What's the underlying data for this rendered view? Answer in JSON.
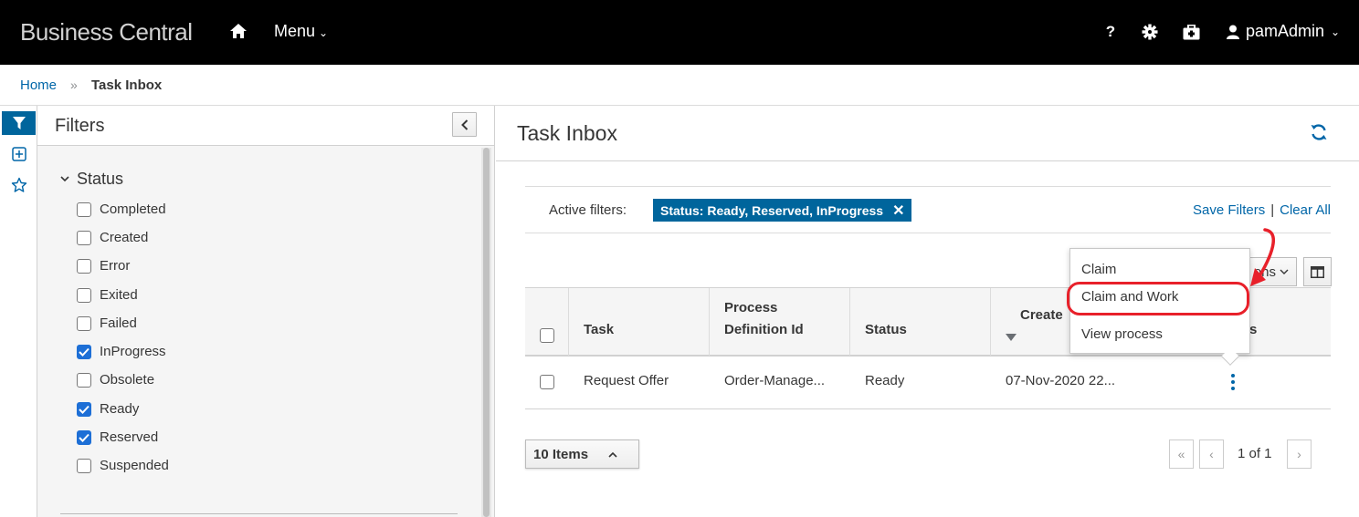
{
  "navbar": {
    "brand": "Business Central",
    "menu_label": "Menu",
    "help_label": "?",
    "user_label": "pamAdmin"
  },
  "breadcrumb": {
    "home": "Home",
    "separator": "»",
    "current": "Task Inbox"
  },
  "filters": {
    "title": "Filters",
    "status_heading": "Status",
    "statuses": [
      {
        "label": "Completed",
        "checked": false
      },
      {
        "label": "Created",
        "checked": false
      },
      {
        "label": "Error",
        "checked": false
      },
      {
        "label": "Exited",
        "checked": false
      },
      {
        "label": "Failed",
        "checked": false
      },
      {
        "label": "InProgress",
        "checked": true
      },
      {
        "label": "Obsolete",
        "checked": false
      },
      {
        "label": "Ready",
        "checked": true
      },
      {
        "label": "Reserved",
        "checked": true
      },
      {
        "label": "Suspended",
        "checked": false
      }
    ]
  },
  "main": {
    "title": "Task Inbox",
    "active_filters_label": "Active filters:",
    "active_filter_chip": "Status: Ready, Reserved, InProgress",
    "chip_close": "✕",
    "save_filters": "Save Filters",
    "link_separator": "|",
    "clear_all": "Clear All",
    "actions_button_partial": "ons",
    "table": {
      "headers": [
        "Task",
        "Process Definition Id",
        "Status",
        "Create",
        "s"
      ],
      "rows": [
        {
          "task": "Request Offer",
          "process_definition_id": "Order-Manage...",
          "status": "Ready",
          "created": "07-Nov-2020 22..."
        }
      ]
    },
    "page_size": "10 Items",
    "pagination_text": "1 of 1"
  },
  "dropdown": {
    "items": [
      "Claim",
      "Claim and Work",
      "View process"
    ]
  },
  "colors": {
    "accent": "#0066a8",
    "chip_bg": "#00659c",
    "highlight": "#e8202a",
    "checkbox_checked": "#1d6fd6"
  }
}
